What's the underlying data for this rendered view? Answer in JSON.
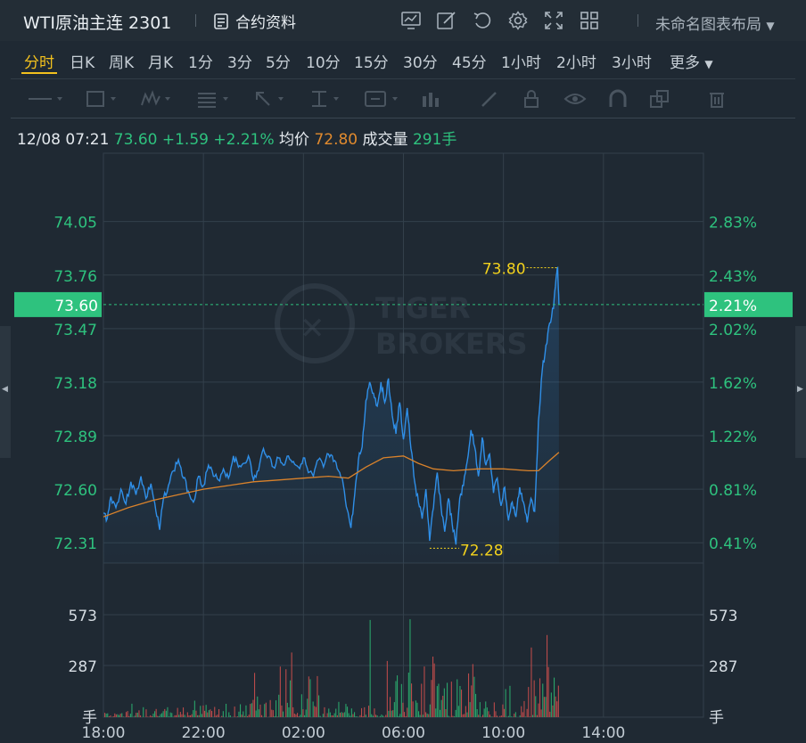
{
  "header": {
    "title": "WTI原油主连 2301",
    "contract_label": "合约资料",
    "layout_label": "未命名图表布局"
  },
  "toolbar_icons": [
    "chart-indicator-icon",
    "edit-icon",
    "undo-icon",
    "settings-icon",
    "fullscreen-icon",
    "grid-layout-icon"
  ],
  "periods": [
    "分时",
    "日K",
    "周K",
    "月K",
    "1分",
    "3分",
    "5分",
    "10分",
    "15分",
    "30分",
    "45分",
    "1小时",
    "2小时",
    "3小时",
    "更多"
  ],
  "active_period": "分时",
  "draw_tools": [
    "line-tool-icon",
    "rectangle-tool-icon",
    "wave-tool-icon",
    "fib-tool-icon",
    "arrow-tool-icon",
    "measure-tool-icon",
    "text-tool-icon",
    "pattern-tool-icon",
    "pen-icon",
    "lock-icon",
    "eye-icon",
    "magnet-icon",
    "copy-icon",
    "trash-icon"
  ],
  "info": {
    "datetime": "12/08 07:21",
    "price": "73.60",
    "change": "+1.59",
    "change_pct": "+2.21%",
    "avg_label": "均价",
    "avg_value": "72.80",
    "vol_label": "成交量",
    "vol_value": "291手"
  },
  "colors": {
    "up": "#2ec27e",
    "price_line": "#2f8fe8",
    "avg_line": "#d9822b",
    "marker": "#f3d21d",
    "vol_up": "#2aa36a",
    "vol_down": "#b94a4a"
  },
  "watermark": [
    "TIGER",
    "BROKERS"
  ],
  "chart_data": {
    "type": "line",
    "x_ticks": [
      "18:00",
      "22:00",
      "02:00",
      "06:00",
      "10:00",
      "14:00"
    ],
    "y_ticks_price": [
      "74.05",
      "73.76",
      "73.47",
      "73.18",
      "72.89",
      "72.60",
      "72.31"
    ],
    "y_ticks_pct": [
      "2.83%",
      "2.43%",
      "2.02%",
      "1.62%",
      "1.22%",
      "0.81%",
      "0.41%"
    ],
    "ylim": [
      72.2,
      74.42
    ],
    "x_range_hours": [
      0,
      24
    ],
    "current_price": "73.60",
    "current_pct": "2.21%",
    "high_label": "73.80",
    "low_label": "72.28",
    "vol_ticks": [
      "573",
      "287"
    ],
    "vol_unit": "手",
    "price_series": [
      [
        0.0,
        72.47
      ],
      [
        0.15,
        72.44
      ],
      [
        0.3,
        72.56
      ],
      [
        0.5,
        72.5
      ],
      [
        0.7,
        72.6
      ],
      [
        0.9,
        72.52
      ],
      [
        1.1,
        72.64
      ],
      [
        1.3,
        72.57
      ],
      [
        1.5,
        72.67
      ],
      [
        1.7,
        72.55
      ],
      [
        1.9,
        72.63
      ],
      [
        2.1,
        72.48
      ],
      [
        2.25,
        72.38
      ],
      [
        2.4,
        72.55
      ],
      [
        2.6,
        72.62
      ],
      [
        2.8,
        72.7
      ],
      [
        3.0,
        72.76
      ],
      [
        3.2,
        72.66
      ],
      [
        3.4,
        72.59
      ],
      [
        3.6,
        72.53
      ],
      [
        3.8,
        72.67
      ],
      [
        4.0,
        72.62
      ],
      [
        4.2,
        72.73
      ],
      [
        4.4,
        72.67
      ],
      [
        4.6,
        72.65
      ],
      [
        4.8,
        72.71
      ],
      [
        5.0,
        72.66
      ],
      [
        5.2,
        72.78
      ],
      [
        5.4,
        72.72
      ],
      [
        5.6,
        72.74
      ],
      [
        5.8,
        72.78
      ],
      [
        6.0,
        72.65
      ],
      [
        6.2,
        72.7
      ],
      [
        6.4,
        72.82
      ],
      [
        6.6,
        72.78
      ],
      [
        6.8,
        72.72
      ],
      [
        7.0,
        72.77
      ],
      [
        7.2,
        72.73
      ],
      [
        7.4,
        72.78
      ],
      [
        7.6,
        72.75
      ],
      [
        7.8,
        72.72
      ],
      [
        8.0,
        72.77
      ],
      [
        8.2,
        72.69
      ],
      [
        8.4,
        72.67
      ],
      [
        8.6,
        72.76
      ],
      [
        8.8,
        72.72
      ],
      [
        9.0,
        72.79
      ],
      [
        9.2,
        72.75
      ],
      [
        9.4,
        72.7
      ],
      [
        9.6,
        72.62
      ],
      [
        9.75,
        72.49
      ],
      [
        9.9,
        72.39
      ],
      [
        10.05,
        72.57
      ],
      [
        10.2,
        72.76
      ],
      [
        10.35,
        72.83
      ],
      [
        10.5,
        73.08
      ],
      [
        10.65,
        73.18
      ],
      [
        10.8,
        73.12
      ],
      [
        10.95,
        73.05
      ],
      [
        11.1,
        73.18
      ],
      [
        11.25,
        73.07
      ],
      [
        11.4,
        73.2
      ],
      [
        11.55,
        73.0
      ],
      [
        11.7,
        72.9
      ],
      [
        11.85,
        73.07
      ],
      [
        12.0,
        72.87
      ],
      [
        12.15,
        73.04
      ],
      [
        12.3,
        72.82
      ],
      [
        12.45,
        72.64
      ],
      [
        12.6,
        72.53
      ],
      [
        12.75,
        72.44
      ],
      [
        12.9,
        72.6
      ],
      [
        13.05,
        72.32
      ],
      [
        13.2,
        72.5
      ],
      [
        13.35,
        72.69
      ],
      [
        13.5,
        72.51
      ],
      [
        13.65,
        72.37
      ],
      [
        13.8,
        72.55
      ],
      [
        13.95,
        72.41
      ],
      [
        14.1,
        72.3
      ],
      [
        14.25,
        72.55
      ],
      [
        14.4,
        72.62
      ],
      [
        14.55,
        72.75
      ],
      [
        14.7,
        72.92
      ],
      [
        14.85,
        72.83
      ],
      [
        15.0,
        72.67
      ],
      [
        15.15,
        72.88
      ],
      [
        15.3,
        72.73
      ],
      [
        15.45,
        72.79
      ],
      [
        15.6,
        72.58
      ],
      [
        15.75,
        72.66
      ],
      [
        15.9,
        72.51
      ],
      [
        16.05,
        72.61
      ],
      [
        16.2,
        72.43
      ],
      [
        16.35,
        72.53
      ],
      [
        16.5,
        72.45
      ],
      [
        16.65,
        72.61
      ],
      [
        16.8,
        72.53
      ],
      [
        16.95,
        72.42
      ],
      [
        17.1,
        72.55
      ],
      [
        17.25,
        72.48
      ],
      [
        17.4,
        72.97
      ],
      [
        17.55,
        73.24
      ],
      [
        17.7,
        73.38
      ],
      [
        17.85,
        73.5
      ],
      [
        18.0,
        73.58
      ],
      [
        18.1,
        73.74
      ],
      [
        18.17,
        73.8
      ],
      [
        18.22,
        73.6
      ]
    ],
    "avg_series": [
      [
        0.0,
        72.45
      ],
      [
        1.0,
        72.5
      ],
      [
        2.0,
        72.54
      ],
      [
        3.0,
        72.57
      ],
      [
        4.0,
        72.6
      ],
      [
        5.0,
        72.62
      ],
      [
        6.0,
        72.64
      ],
      [
        7.0,
        72.65
      ],
      [
        8.0,
        72.66
      ],
      [
        9.0,
        72.67
      ],
      [
        9.8,
        72.66
      ],
      [
        10.5,
        72.72
      ],
      [
        11.2,
        72.77
      ],
      [
        12.0,
        72.78
      ],
      [
        12.6,
        72.74
      ],
      [
        13.2,
        72.71
      ],
      [
        14.0,
        72.7
      ],
      [
        15.0,
        72.71
      ],
      [
        16.0,
        72.71
      ],
      [
        17.0,
        72.7
      ],
      [
        17.4,
        72.7
      ],
      [
        17.8,
        72.75
      ],
      [
        18.22,
        72.8
      ]
    ]
  }
}
